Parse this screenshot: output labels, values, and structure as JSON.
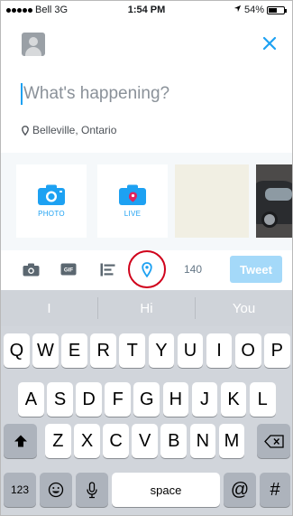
{
  "status_bar": {
    "carrier": "Bell",
    "network": "3G",
    "time": "1:54 PM",
    "battery_text": "54%",
    "battery_level": 0.54
  },
  "compose": {
    "placeholder": "What's happening?",
    "location": "Belleville, Ontario"
  },
  "media": {
    "photo_label": "PHOTO",
    "live_label": "LIVE"
  },
  "toolbar": {
    "char_count": "140",
    "tweet_label": "Tweet",
    "icons": [
      "camera-icon",
      "gif-icon",
      "poll-icon",
      "location-pin-icon"
    ]
  },
  "keyboard": {
    "suggestions": [
      "I",
      "Hi",
      "You"
    ],
    "row1": [
      "Q",
      "W",
      "E",
      "R",
      "T",
      "Y",
      "U",
      "I",
      "O",
      "P"
    ],
    "row2": [
      "A",
      "S",
      "D",
      "F",
      "G",
      "H",
      "J",
      "K",
      "L"
    ],
    "row3": [
      "Z",
      "X",
      "C",
      "V",
      "B",
      "N",
      "M"
    ],
    "numbers_label": "123",
    "space_label": "space",
    "at_label": "@",
    "hash_label": "#"
  },
  "colors": {
    "accent": "#1da1f2",
    "tweet_button": "#a4d9f9",
    "highlight_ring": "#d0021b",
    "keyboard_bg": "#d1d5db"
  }
}
